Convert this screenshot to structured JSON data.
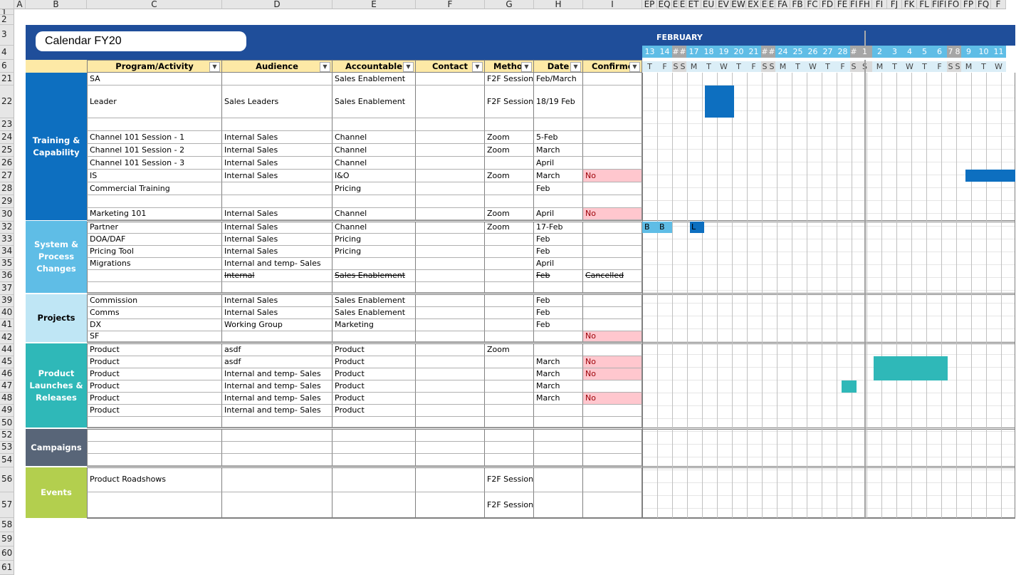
{
  "columns": [
    "A",
    "B",
    "C",
    "D",
    "E",
    "F",
    "G",
    "H",
    "I"
  ],
  "timeline_columns": [
    "EP",
    "EQ",
    "E",
    "E",
    "ET",
    "EU",
    "EV",
    "EW",
    "EX",
    "E",
    "E",
    "FA",
    "FB",
    "FC",
    "FD",
    "FE",
    "FI",
    "FH",
    "FI",
    "FJ",
    "FK",
    "FL",
    "FI",
    "FI",
    "FO",
    "FP",
    "FQ",
    "F"
  ],
  "rows": [
    "1",
    "2",
    "3",
    "4",
    "6",
    "21",
    "22",
    "23",
    "24",
    "25",
    "26",
    "27",
    "28",
    "29",
    "30",
    "32",
    "33",
    "34",
    "35",
    "36",
    "37",
    "39",
    "40",
    "41",
    "42",
    "44",
    "45",
    "46",
    "47",
    "48",
    "49",
    "50",
    "52",
    "53",
    "54",
    "56",
    "57",
    "58",
    "59",
    "60",
    "61"
  ],
  "title": "Calendar FY20",
  "month": "FEBRUARY",
  "day_numbers": [
    "13",
    "14",
    "#",
    "#",
    "17",
    "18",
    "19",
    "20",
    "21",
    "#",
    "#",
    "24",
    "25",
    "26",
    "27",
    "28",
    "#",
    "1",
    "2",
    "3",
    "4",
    "5",
    "6",
    "7",
    "8",
    "9",
    "10",
    "11"
  ],
  "day_letters": [
    "T",
    "F",
    "S",
    "S",
    "M",
    "T",
    "W",
    "T",
    "F",
    "S",
    "S",
    "M",
    "T",
    "W",
    "T",
    "F",
    "S",
    "S",
    "M",
    "T",
    "W",
    "T",
    "F",
    "S",
    "S",
    "M",
    "T",
    "W"
  ],
  "headers": {
    "program": "Program/Activity",
    "audience": "Audience",
    "accountable": "Accountable",
    "contact": "Contact",
    "method": "Metho",
    "date": "Date",
    "confirmed": "Confirme"
  },
  "categories": {
    "training": "Training &\nCapability",
    "system": "System &\nProcess\nChanges",
    "projects": "Projects",
    "launches": "Product\nLaunches &\nReleases",
    "campaigns": "Campaigns",
    "events": "Events"
  },
  "table_rows": [
    {
      "program": "SA",
      "audience": "",
      "accountable": "Sales Enablement",
      "method": "F2F Session",
      "date": "Feb/March",
      "confirmed": ""
    },
    {
      "program": "Leader",
      "audience": "Sales Leaders",
      "accountable": "Sales Enablement",
      "method": "F2F Session",
      "date": "18/19 Feb",
      "confirmed": ""
    },
    {
      "program": "",
      "audience": "",
      "accountable": "",
      "method": "",
      "date": "",
      "confirmed": ""
    },
    {
      "program": "Channel 101 Session - 1",
      "audience": "Internal Sales",
      "accountable": "Channel",
      "method": "Zoom",
      "date": "5-Feb",
      "confirmed": ""
    },
    {
      "program": "Channel 101 Session - 2",
      "audience": "Internal Sales",
      "accountable": "Channel",
      "method": "Zoom",
      "date": "March",
      "confirmed": ""
    },
    {
      "program": "Channel 101 Session - 3",
      "audience": "Internal Sales",
      "accountable": "Channel",
      "method": "",
      "date": "April",
      "confirmed": ""
    },
    {
      "program": "IS",
      "audience": "Internal Sales",
      "accountable": "I&O",
      "method": "Zoom",
      "date": "March",
      "confirmed": "No"
    },
    {
      "program": "Commercial Training",
      "audience": "",
      "accountable": "Pricing",
      "method": "",
      "date": "Feb",
      "confirmed": ""
    },
    {
      "program": "",
      "audience": "",
      "accountable": "",
      "method": "",
      "date": "",
      "confirmed": ""
    },
    {
      "program": "Marketing 101",
      "audience": "Internal Sales",
      "accountable": "Channel",
      "method": "Zoom",
      "date": "April",
      "confirmed": "No"
    },
    {
      "program": "Partner",
      "audience": "Internal Sales",
      "accountable": "Channel",
      "method": "Zoom",
      "date": "17-Feb",
      "confirmed": ""
    },
    {
      "program": "DOA/DAF",
      "audience": "Internal Sales",
      "accountable": "Pricing",
      "method": "",
      "date": "Feb",
      "confirmed": ""
    },
    {
      "program": "Pricing Tool",
      "audience": "Internal Sales",
      "accountable": "Pricing",
      "method": "",
      "date": "Feb",
      "confirmed": ""
    },
    {
      "program": " Migrations",
      "audience": "Internal and temp- Sales",
      "accountable": "",
      "method": "",
      "date": "April",
      "confirmed": ""
    },
    {
      "program": "",
      "audience": "Internal",
      "accountable": "Sales Enablement",
      "method": "",
      "date": "Feb",
      "confirmed": "Cancelled"
    },
    {
      "program": "",
      "audience": "",
      "accountable": "",
      "method": "",
      "date": "",
      "confirmed": ""
    },
    {
      "program": "Commission",
      "audience": "Internal Sales",
      "accountable": "Sales Enablement",
      "method": "",
      "date": "Feb",
      "confirmed": ""
    },
    {
      "program": "Comms",
      "audience": "Internal Sales",
      "accountable": "Sales Enablement",
      "method": "",
      "date": "Feb",
      "confirmed": ""
    },
    {
      "program": "DX",
      "audience": "Working Group",
      "accountable": "Marketing",
      "method": "",
      "date": "Feb",
      "confirmed": ""
    },
    {
      "program": "SF",
      "audience": "",
      "accountable": "",
      "method": "",
      "date": "",
      "confirmed": "No"
    },
    {
      "program": "Product",
      "audience": "asdf",
      "accountable": "Product",
      "method": "Zoom",
      "date": "",
      "confirmed": ""
    },
    {
      "program": "Product",
      "audience": "asdf",
      "accountable": "Product",
      "method": "",
      "date": "March",
      "confirmed": "No"
    },
    {
      "program": "Product",
      "audience": "Internal and temp- Sales",
      "accountable": "Product",
      "method": "",
      "date": "March",
      "confirmed": "No"
    },
    {
      "program": "Product",
      "audience": "Internal and temp- Sales",
      "accountable": "Product",
      "method": "",
      "date": "March",
      "confirmed": ""
    },
    {
      "program": "Product",
      "audience": "Internal and temp- Sales",
      "accountable": "Product",
      "method": "",
      "date": "March",
      "confirmed": "No"
    },
    {
      "program": "Product",
      "audience": "Internal and temp- Sales",
      "accountable": "Product",
      "method": "",
      "date": "",
      "confirmed": ""
    },
    {
      "program": "",
      "audience": "",
      "accountable": "",
      "method": "",
      "date": "",
      "confirmed": ""
    },
    {
      "program": "",
      "audience": "",
      "accountable": "",
      "method": "",
      "date": "",
      "confirmed": ""
    },
    {
      "program": "",
      "audience": "",
      "accountable": "",
      "method": "",
      "date": "",
      "confirmed": ""
    },
    {
      "program": "",
      "audience": "",
      "accountable": "",
      "method": "",
      "date": "",
      "confirmed": ""
    },
    {
      "program": "Product Roadshows",
      "audience": "",
      "accountable": "",
      "method": "F2F Session",
      "date": "",
      "confirmed": ""
    },
    {
      "program": "",
      "audience": "",
      "accountable": "",
      "method": "F2F Session",
      "date": "",
      "confirmed": ""
    }
  ],
  "gantt_labels": {
    "b1": "B",
    "b2": "B",
    "l": "L"
  },
  "colors": {
    "navy": "#1f4e9a",
    "training": "#0d6fc0",
    "system": "#5fbde6",
    "projects": "#bfe6f5",
    "launches": "#2fb8b8",
    "campaigns": "#586578",
    "events": "#b3cf4e",
    "header_yellow": "#fde9a6",
    "no_fill": "#ffc7ce"
  }
}
